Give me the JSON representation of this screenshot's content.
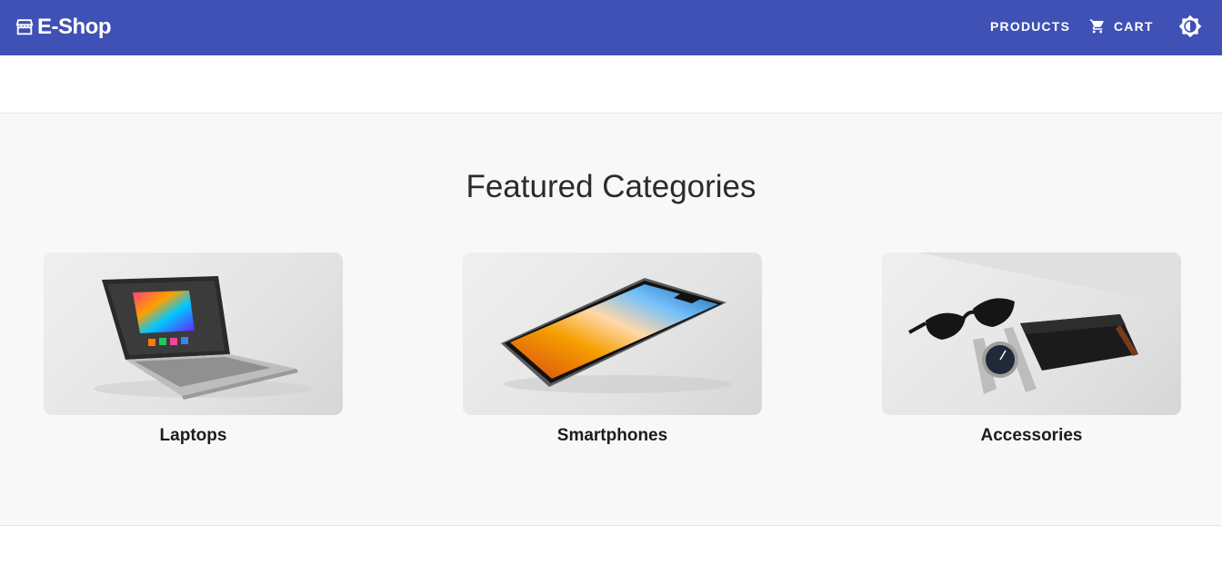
{
  "header": {
    "brand": "E-Shop",
    "nav": {
      "products_label": "PRODUCTS",
      "cart_label": "CART"
    }
  },
  "colors": {
    "appbar": "#3f51b5",
    "section_bg": "#f8f8f8"
  },
  "featured": {
    "title": "Featured Categories",
    "categories": [
      {
        "label": "Laptops"
      },
      {
        "label": "Smartphones"
      },
      {
        "label": "Accessories"
      }
    ]
  }
}
